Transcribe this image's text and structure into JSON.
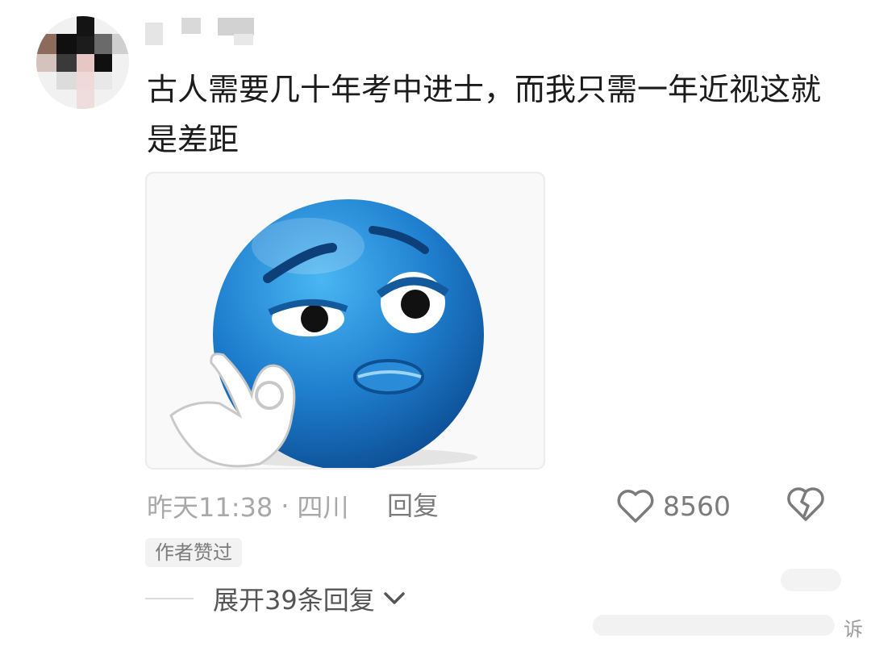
{
  "comment": {
    "text": "古人需要几十年考中进士，而我只需一年近视这就是差距",
    "time": "昨天11:38",
    "separator": "·",
    "location": "四川",
    "reply_label": "回复",
    "likes": "8560",
    "author_badge": "作者赞过",
    "expand_label": "展开39条回复",
    "image_icon": "blue-emoji-ok-hand"
  },
  "watermark": {
    "glyph": "诉"
  },
  "colors": {
    "text_primary": "#1b1b1b",
    "text_secondary": "#a8a8a8",
    "action_gray": "#7b7b7b",
    "emoji_blue": "#1f7fcf"
  }
}
